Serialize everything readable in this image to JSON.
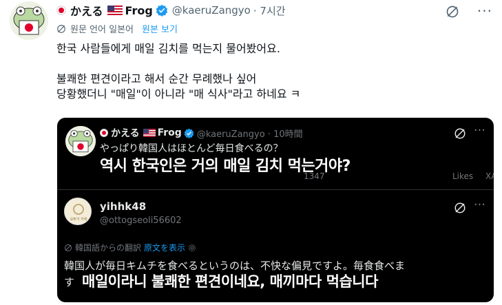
{
  "tweet": {
    "display_name": "かえる",
    "flag_label": "Frog",
    "handle": "@kaeruZangyo",
    "time": "· 7시간",
    "more": "···",
    "translate_label": "원문 언어 일본어",
    "show_original": "원본 보기",
    "body": [
      "한국 사람들에게 매일 김치를 먹는지 물어봤어요.",
      "",
      "불쾌한 편견이라고 해서 순간 무례했나 싶어",
      "당황했더니 \"매일\"이 아니라 \"매 식사\"라고 하네요 ㅋ"
    ]
  },
  "quote": {
    "display_name": "かえる",
    "flag_label": "Frog",
    "handle": "@kaeruZangyo · 10時間",
    "jp_text": "やっぱり韓国人はほとんど毎日食べるの？",
    "overlay_text": "역시 한국인은 거의 매일 김치 먹는거야?",
    "likes_label": "Likes",
    "xa_label": "XA",
    "views": "1347",
    "more": "···"
  },
  "reply": {
    "name": "yihhk48",
    "handle": "@ottogseoli56602",
    "avatar_caption": "오뚜기 가게",
    "translate_label": "韓国語からの翻訳",
    "show_original": "原文を表示",
    "jp_text": "韓国人が毎日キムチを食べるというのは、不快な偏見ですよ。毎食食べま",
    "jp_text_2": "す",
    "overlay_text": "매일이라니 불쾌한 편견이네요, 매끼마다 먹습니다",
    "more": "···"
  },
  "colors": {
    "accent": "#1d9bf0",
    "text": "#0f1419",
    "muted": "#536471",
    "dark_bg": "#000000",
    "jp_red": "#e0002a"
  },
  "icons": [
    "frog-avatar-icon",
    "japan-flag-icon",
    "us-flag-icon",
    "verified-badge-icon",
    "grok-icon",
    "translate-icon",
    "gear-icon"
  ]
}
